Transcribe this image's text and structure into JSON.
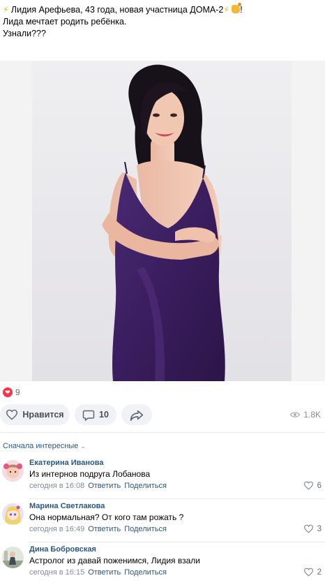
{
  "post": {
    "title_line": "Лидия Арефьева, 43 года, новая участница ДОМА-2",
    "title_suffix": "!",
    "body_line1": "Лида мечтает родить ребёнка.",
    "body_line2": "Узнали???",
    "emoji_bolt": "⚡",
    "emoji_hand": "waving-hand-icon"
  },
  "reactions": {
    "count": "9",
    "icon": "heart-icon",
    "color": "#ff3347"
  },
  "actions": {
    "like_label": "Нравится",
    "comments_count": "10",
    "share_icon": "share-arrow-icon",
    "views": "1.8K"
  },
  "sort": {
    "label": "Сначала интересные"
  },
  "comments": [
    {
      "author": "Екатерина Иванова",
      "text": "Из интернов подруга Лобанова",
      "time": "сегодня в 16:08",
      "reply": "Ответить",
      "share": "Поделиться",
      "likes": "6"
    },
    {
      "author": "Марина Светлакова",
      "text": "Она нормальная? От кого там рожать ?",
      "time": "сегодня в 16:49",
      "reply": "Ответить",
      "share": "Поделиться",
      "likes": "3"
    },
    {
      "author": "Дина Бобровская",
      "text": "Астролог из давай поженимся, Лидия взали",
      "time": "сегодня в 16:15",
      "reply": "Ответить",
      "share": "Поделиться",
      "likes": "2"
    }
  ],
  "colors": {
    "link": "#2a5885",
    "muted": "#818c99",
    "pill_bg": "#f0f2f5",
    "dress": "#3d2060"
  }
}
